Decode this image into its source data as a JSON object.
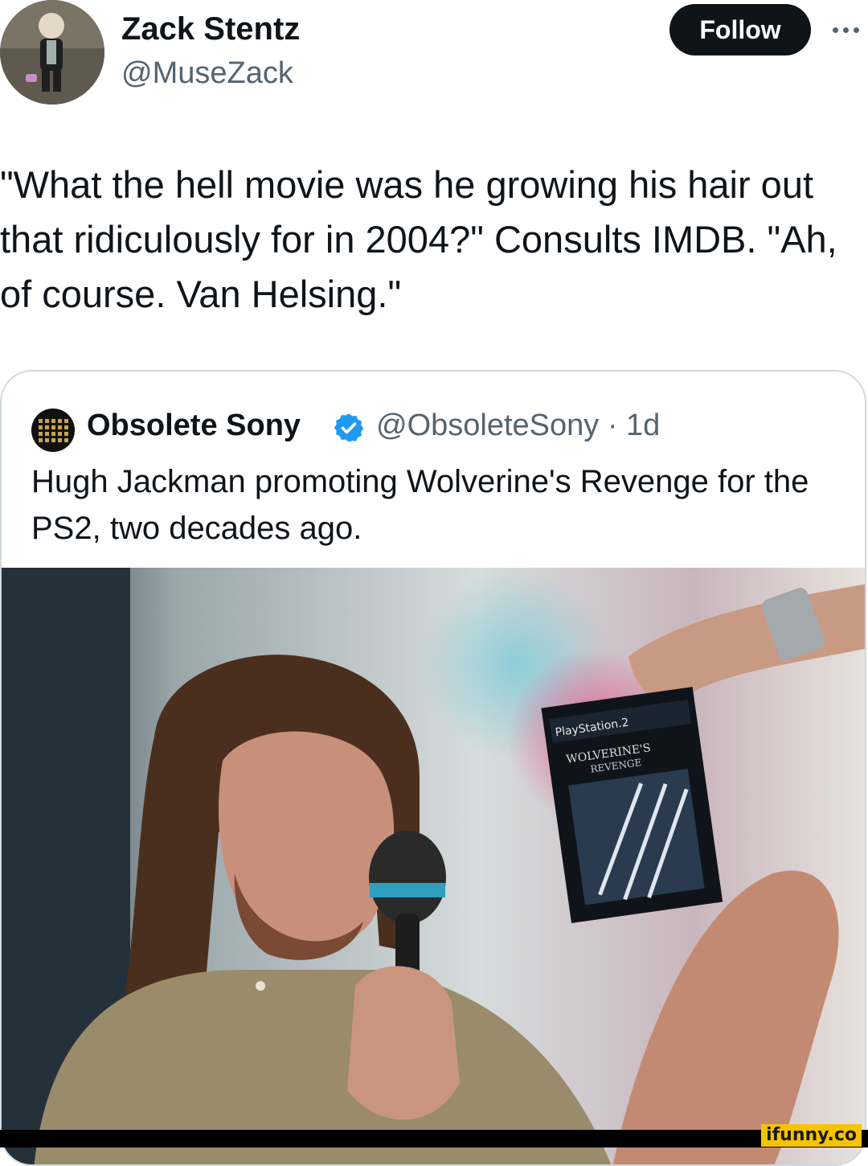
{
  "tweet": {
    "author": {
      "display_name": "Zack Stentz",
      "handle": "@MuseZack"
    },
    "follow_label": "Follow",
    "text": "\"What the hell movie was he growing his hair out that ridiculously for in 2004?\" Consults IMDB. \"Ah, of course. Van Helsing.\""
  },
  "quoted_tweet": {
    "display_name": "Obsolete Sony",
    "verified": true,
    "handle_time": "@ObsoleteSony · 1d",
    "text": "Hugh Jackman promoting Wolverine's Revenge for the PS2, two decades ago.",
    "photo": {
      "game_box_labels": [
        "PlayStation.2",
        "WOLVERINE'S",
        "REVENGE"
      ]
    }
  },
  "watermark": "ifunny.co",
  "colors": {
    "text_primary": "#0f1419",
    "text_secondary": "#536471",
    "verified_blue": "#1d9bf0",
    "border": "#cfd9de",
    "ifunny_yellow": "#f6c300"
  }
}
